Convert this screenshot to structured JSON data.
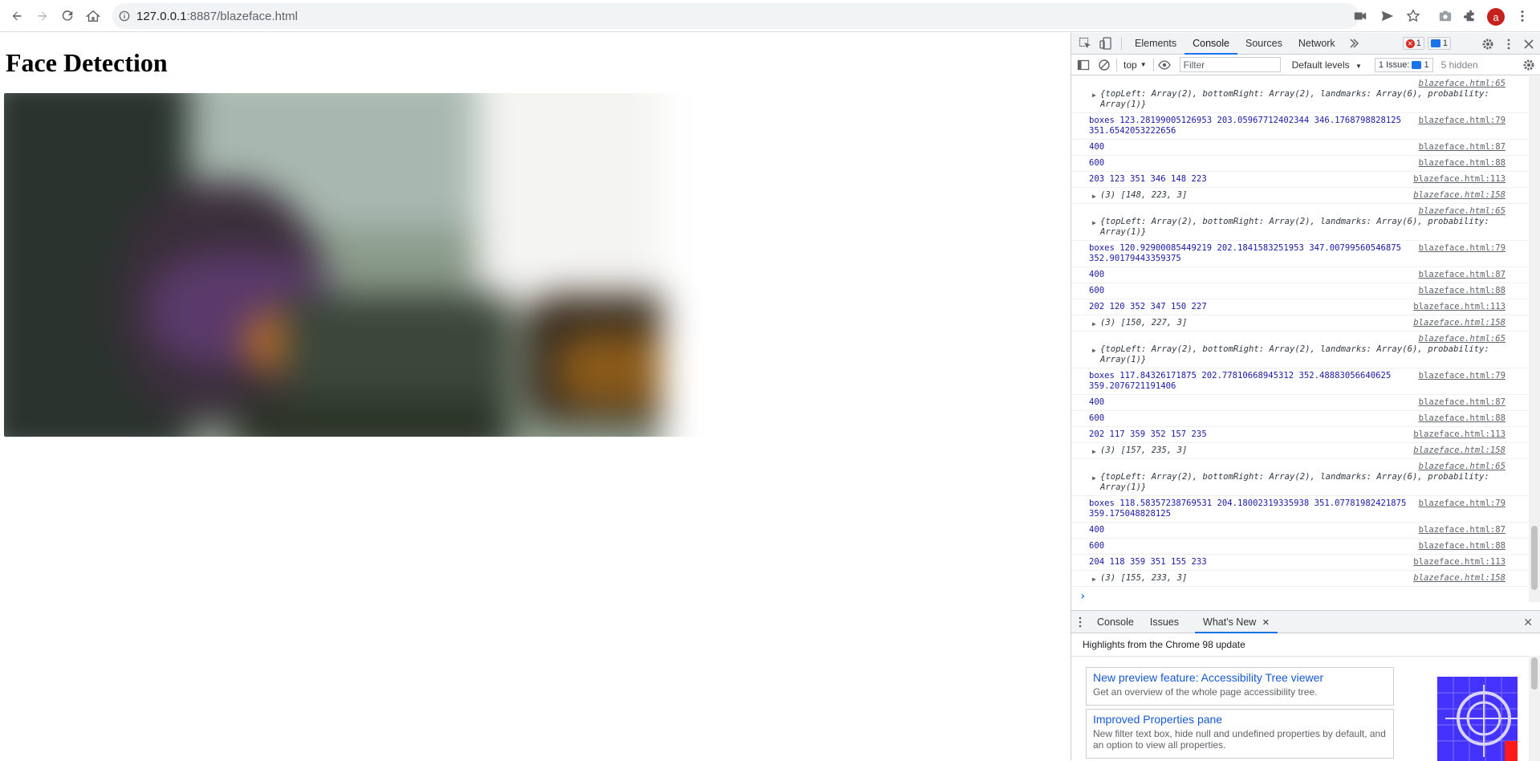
{
  "browser": {
    "url_host": "127.0.0.1",
    "url_path": ":8887/blazeface.html",
    "avatar_letter": "a"
  },
  "page": {
    "title": "Face Detection"
  },
  "devtools": {
    "tabs": [
      "Elements",
      "Console",
      "Sources",
      "Network"
    ],
    "active_tab": "Console",
    "error_count": "1",
    "message_count": "1",
    "context": "top",
    "filter_placeholder": "Filter",
    "levels": "Default levels",
    "issues_label": "1 Issue:",
    "issues_count": "1",
    "hidden": "5 hidden"
  },
  "console_rows": [
    {
      "kind": "obj",
      "text": "{topLeft: Array(2), bottomRight: Array(2), landmarks: Array(6), probability: Array(1)}",
      "src": "blazeface.html:65"
    },
    {
      "kind": "log",
      "text": "boxes 123.28199005126953 203.05967712402344 346.1768798828125 351.6542053222656",
      "src": "blazeface.html:79"
    },
    {
      "kind": "log",
      "text": "400",
      "src": "blazeface.html:87"
    },
    {
      "kind": "log",
      "text": "600",
      "src": "blazeface.html:88"
    },
    {
      "kind": "log",
      "text": "203 123 351 346 148 223",
      "src": "blazeface.html:113"
    },
    {
      "kind": "arr",
      "text": "(3) [148, 223, 3]",
      "src": "blazeface.html:158"
    },
    {
      "kind": "obj",
      "text": "{topLeft: Array(2), bottomRight: Array(2), landmarks: Array(6), probability: Array(1)}",
      "src": "blazeface.html:65"
    },
    {
      "kind": "log",
      "text": "boxes 120.92900085449219 202.1841583251953 347.00799560546875 352.90179443359375",
      "src": "blazeface.html:79"
    },
    {
      "kind": "log",
      "text": "400",
      "src": "blazeface.html:87"
    },
    {
      "kind": "log",
      "text": "600",
      "src": "blazeface.html:88"
    },
    {
      "kind": "log",
      "text": "202 120 352 347 150 227",
      "src": "blazeface.html:113"
    },
    {
      "kind": "arr",
      "text": "(3) [150, 227, 3]",
      "src": "blazeface.html:158"
    },
    {
      "kind": "obj",
      "text": "{topLeft: Array(2), bottomRight: Array(2), landmarks: Array(6), probability: Array(1)}",
      "src": "blazeface.html:65"
    },
    {
      "kind": "log",
      "text": "boxes 117.84326171875 202.77810668945312 352.48883056640625 359.2076721191406",
      "src": "blazeface.html:79"
    },
    {
      "kind": "log",
      "text": "400",
      "src": "blazeface.html:87"
    },
    {
      "kind": "log",
      "text": "600",
      "src": "blazeface.html:88"
    },
    {
      "kind": "log",
      "text": "202 117 359 352 157 235",
      "src": "blazeface.html:113"
    },
    {
      "kind": "arr",
      "text": "(3) [157, 235, 3]",
      "src": "blazeface.html:158"
    },
    {
      "kind": "obj",
      "text": "{topLeft: Array(2), bottomRight: Array(2), landmarks: Array(6), probability: Array(1)}",
      "src": "blazeface.html:65"
    },
    {
      "kind": "log",
      "text": "boxes 118.58357238769531 204.18002319335938 351.07781982421875 359.175048828125",
      "src": "blazeface.html:79"
    },
    {
      "kind": "log",
      "text": "400",
      "src": "blazeface.html:87"
    },
    {
      "kind": "log",
      "text": "600",
      "src": "blazeface.html:88"
    },
    {
      "kind": "log",
      "text": "204 118 359 351 155 233",
      "src": "blazeface.html:113"
    },
    {
      "kind": "arr",
      "text": "(3) [155, 233, 3]",
      "src": "blazeface.html:158"
    }
  ],
  "drawer": {
    "tabs": [
      "Console",
      "Issues",
      "What's New"
    ],
    "active_tab": "What's New",
    "header": "Highlights from the Chrome 98 update",
    "cards": [
      {
        "title": "New preview feature: Accessibility Tree viewer",
        "desc": "Get an overview of the whole page accessibility tree."
      },
      {
        "title": "Improved Properties pane",
        "desc": "New filter text box, hide null and undefined properties by default, and an option to view all properties."
      }
    ]
  }
}
